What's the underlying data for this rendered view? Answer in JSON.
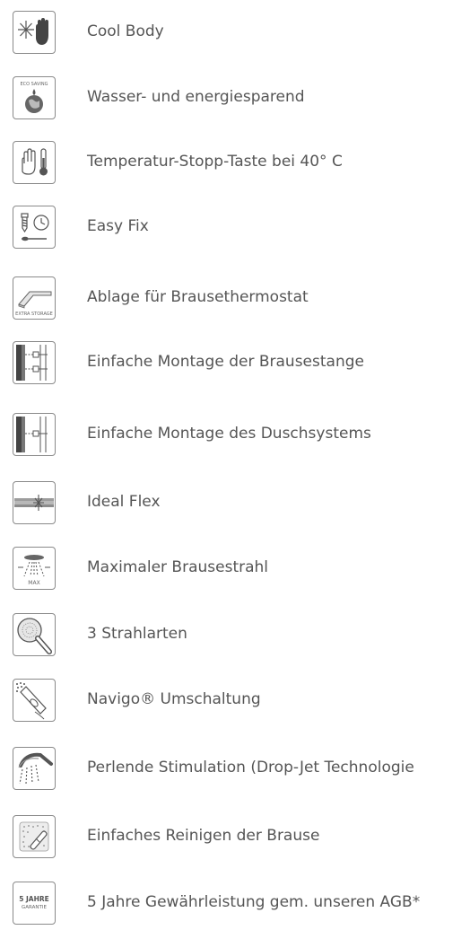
{
  "features": [
    {
      "icon": "cool-body-icon",
      "label": "Cool Body"
    },
    {
      "icon": "eco-saving-icon",
      "icon_text": "ECO SAVING",
      "label": "Wasser- und energiesparend"
    },
    {
      "icon": "temperature-stop-icon",
      "label": "Temperatur-Stopp-Taste bei 40° C"
    },
    {
      "icon": "easy-fix-icon",
      "label": "Easy Fix"
    },
    {
      "icon": "extra-storage-icon",
      "icon_text": "EXTRA STORAGE",
      "label": "Ablage für Brausethermostat"
    },
    {
      "icon": "shower-rail-mount-icon",
      "label": "Einfache Montage der Brausestange"
    },
    {
      "icon": "shower-system-mount-icon",
      "label": "Einfache Montage des Duschsystems"
    },
    {
      "icon": "ideal-flex-icon",
      "label": "Ideal Flex"
    },
    {
      "icon": "max-spray-icon",
      "icon_text": "MAX",
      "label": "Maximaler Brausestrahl"
    },
    {
      "icon": "spray-modes-icon",
      "label": "3 Strahlarten"
    },
    {
      "icon": "navigo-switch-icon",
      "label": "Navigo® Umschaltung"
    },
    {
      "icon": "drop-jet-icon",
      "label": "Perlende Stimulation (Drop-Jet Technologie"
    },
    {
      "icon": "easy-clean-icon",
      "label": "Einfaches Reinigen der Brause"
    },
    {
      "icon": "guarantee-icon",
      "icon_text_line1": "5 JAHRE",
      "icon_text_line2": "GARANTIE",
      "label": "5 Jahre Gewährleistung gem. unseren AGB*"
    }
  ]
}
